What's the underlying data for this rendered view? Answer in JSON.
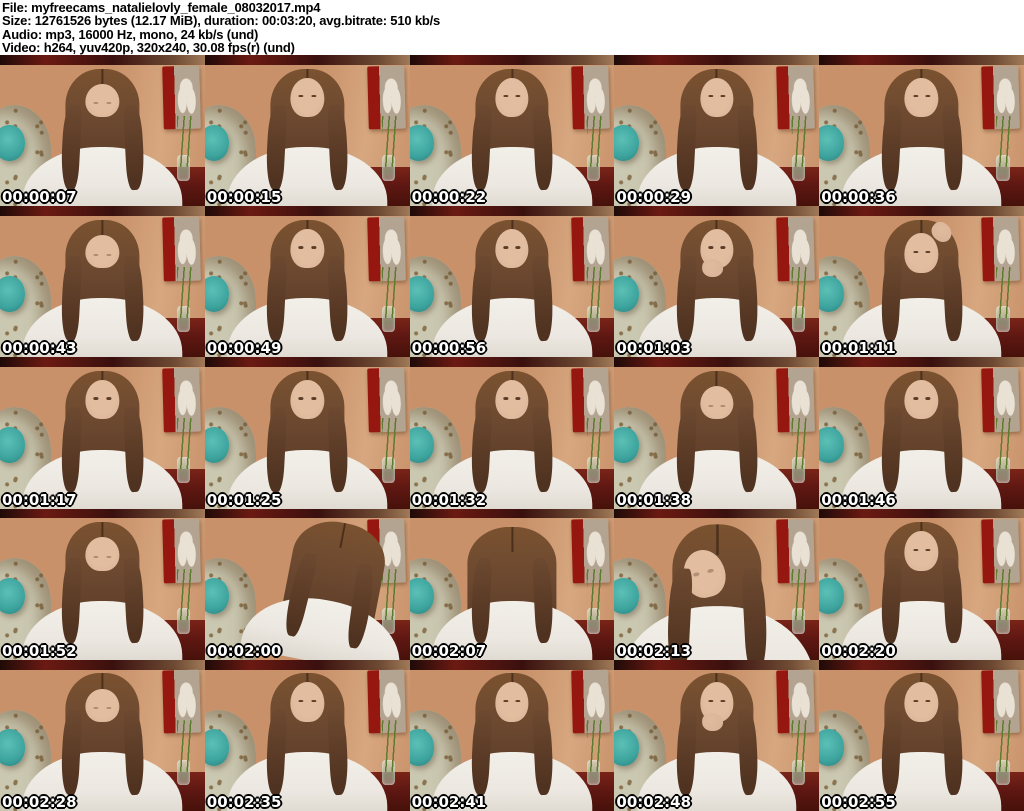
{
  "header": {
    "lines": [
      "File: myfreecams_natalielovly_female_08032017.mp4",
      "Size: 12761526 bytes (12.17 MiB), duration: 00:03:20, avg.bitrate: 510 kb/s",
      "Audio: mp3, 16000 Hz, mono, 24 kb/s (und)",
      "Video: h264, yuv420p, 320x240, 30.08 fps(r) (und)"
    ]
  },
  "palette": {
    "header-bg": "#ffffff",
    "header-text": "#000000",
    "wall": "#c8916a",
    "wall-light": "#d7a77f",
    "topbar": "#3a100e",
    "topbar-red": "#6b1a12",
    "sofa": "#cbc8b1",
    "sofa-speck": "#8a7450",
    "pillow": "#3da49e",
    "painting-red": "#96170f",
    "painting-bg": "#b3a492",
    "flower": "#e9e1d3",
    "plant": "#5d7c2e",
    "table": "#5e1712",
    "vase": "#b9c9b8",
    "hair": "#6d4930",
    "hair-dark": "#4f3220",
    "skin": "#d8b296",
    "shirt": "#ece8e1",
    "timestamp-text": "#ffffff",
    "timestamp-outline": "#000000"
  },
  "thumbnails": [
    {
      "timestamp": "00:00:07",
      "pose": "down"
    },
    {
      "timestamp": "00:00:15",
      "pose": "front"
    },
    {
      "timestamp": "00:00:22",
      "pose": "front"
    },
    {
      "timestamp": "00:00:29",
      "pose": "front"
    },
    {
      "timestamp": "00:00:36",
      "pose": "front"
    },
    {
      "timestamp": "00:00:43",
      "pose": "down"
    },
    {
      "timestamp": "00:00:49",
      "pose": "front"
    },
    {
      "timestamp": "00:00:56",
      "pose": "front"
    },
    {
      "timestamp": "00:01:03",
      "pose": "hand-mouth"
    },
    {
      "timestamp": "00:01:11",
      "pose": "hand-head"
    },
    {
      "timestamp": "00:01:17",
      "pose": "front"
    },
    {
      "timestamp": "00:01:25",
      "pose": "front"
    },
    {
      "timestamp": "00:01:32",
      "pose": "front"
    },
    {
      "timestamp": "00:01:38",
      "pose": "down"
    },
    {
      "timestamp": "00:01:46",
      "pose": "front"
    },
    {
      "timestamp": "00:01:52",
      "pose": "down"
    },
    {
      "timestamp": "00:02:00",
      "pose": "lean-right"
    },
    {
      "timestamp": "00:02:07",
      "pose": "hair-down"
    },
    {
      "timestamp": "00:02:13",
      "pose": "lean-forward"
    },
    {
      "timestamp": "00:02:20",
      "pose": "front"
    },
    {
      "timestamp": "00:02:28",
      "pose": "down"
    },
    {
      "timestamp": "00:02:35",
      "pose": "front"
    },
    {
      "timestamp": "00:02:41",
      "pose": "front"
    },
    {
      "timestamp": "00:02:48",
      "pose": "hand-mouth"
    },
    {
      "timestamp": "00:02:55",
      "pose": "front"
    }
  ]
}
